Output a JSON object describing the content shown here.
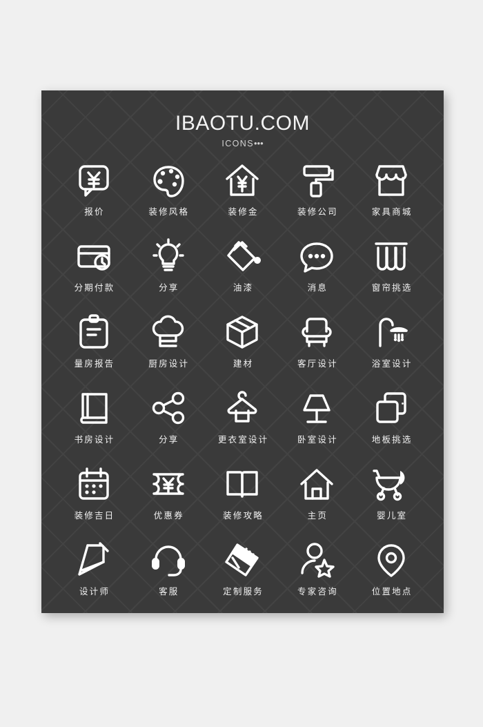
{
  "page": {
    "background_color": "#f0f0f0",
    "panel_color": "#3a3a3a",
    "stroke_color": "#ffffff",
    "label_color": "#f2f2f2"
  },
  "header": {
    "title": "IBAOTU.COM",
    "subtitle": "ICONS",
    "subtitle_dots": "•••"
  },
  "grid": {
    "columns": 5,
    "rows": 6,
    "items": [
      {
        "label": "报价",
        "icon": "price-quote-bubble-icon"
      },
      {
        "label": "装修风格",
        "icon": "palette-icon"
      },
      {
        "label": "装修金",
        "icon": "house-yuan-icon"
      },
      {
        "label": "装修公司",
        "icon": "paint-roller-icon"
      },
      {
        "label": "家具商城",
        "icon": "store-icon"
      },
      {
        "label": "分期付款",
        "icon": "credit-card-clock-icon"
      },
      {
        "label": "分享",
        "icon": "lightbulb-icon"
      },
      {
        "label": "油漆",
        "icon": "paint-bucket-icon"
      },
      {
        "label": "消息",
        "icon": "chat-bubble-icon"
      },
      {
        "label": "窗帘挑选",
        "icon": "curtains-icon"
      },
      {
        "label": "量房报告",
        "icon": "clipboard-icon"
      },
      {
        "label": "厨房设计",
        "icon": "chef-hat-icon"
      },
      {
        "label": "建材",
        "icon": "package-box-icon"
      },
      {
        "label": "客厅设计",
        "icon": "armchair-icon"
      },
      {
        "label": "浴室设计",
        "icon": "shower-icon"
      },
      {
        "label": "书房设计",
        "icon": "book-icon"
      },
      {
        "label": "分享",
        "icon": "share-nodes-icon"
      },
      {
        "label": "更衣室设计",
        "icon": "clothes-hanger-icon"
      },
      {
        "label": "卧室设计",
        "icon": "table-lamp-icon"
      },
      {
        "label": "地板挑选",
        "icon": "layered-squares-icon"
      },
      {
        "label": "装修吉日",
        "icon": "calendar-icon"
      },
      {
        "label": "优惠券",
        "icon": "coupon-yuan-icon"
      },
      {
        "label": "装修攻略",
        "icon": "open-book-icon"
      },
      {
        "label": "主页",
        "icon": "home-icon"
      },
      {
        "label": "婴儿室",
        "icon": "baby-stroller-icon"
      },
      {
        "label": "设计师",
        "icon": "design-pen-icon"
      },
      {
        "label": "客服",
        "icon": "headset-icon"
      },
      {
        "label": "定制服务",
        "icon": "ruler-icon"
      },
      {
        "label": "专家咨询",
        "icon": "person-star-icon"
      },
      {
        "label": "位置地点",
        "icon": "location-pin-icon"
      }
    ]
  }
}
